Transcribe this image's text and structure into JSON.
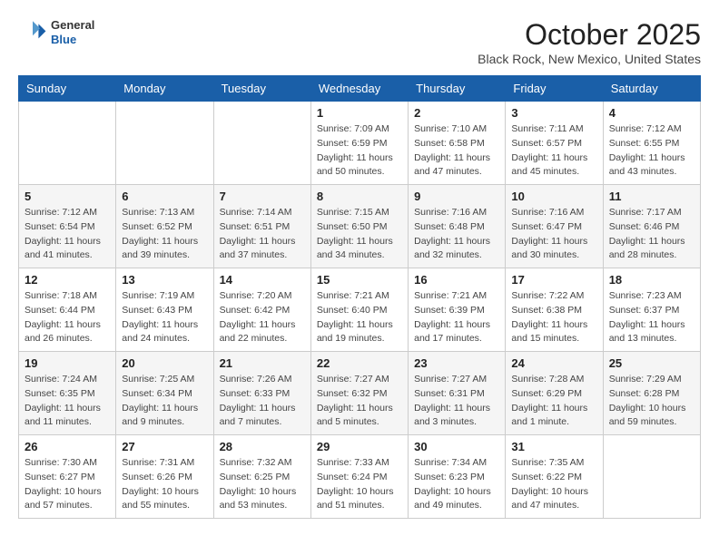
{
  "header": {
    "logo": {
      "line1": "General",
      "line2": "Blue"
    },
    "title": "October 2025",
    "subtitle": "Black Rock, New Mexico, United States"
  },
  "weekdays": [
    "Sunday",
    "Monday",
    "Tuesday",
    "Wednesday",
    "Thursday",
    "Friday",
    "Saturday"
  ],
  "weeks": [
    [
      {
        "day": "",
        "info": ""
      },
      {
        "day": "",
        "info": ""
      },
      {
        "day": "",
        "info": ""
      },
      {
        "day": "1",
        "info": "Sunrise: 7:09 AM\nSunset: 6:59 PM\nDaylight: 11 hours\nand 50 minutes."
      },
      {
        "day": "2",
        "info": "Sunrise: 7:10 AM\nSunset: 6:58 PM\nDaylight: 11 hours\nand 47 minutes."
      },
      {
        "day": "3",
        "info": "Sunrise: 7:11 AM\nSunset: 6:57 PM\nDaylight: 11 hours\nand 45 minutes."
      },
      {
        "day": "4",
        "info": "Sunrise: 7:12 AM\nSunset: 6:55 PM\nDaylight: 11 hours\nand 43 minutes."
      }
    ],
    [
      {
        "day": "5",
        "info": "Sunrise: 7:12 AM\nSunset: 6:54 PM\nDaylight: 11 hours\nand 41 minutes."
      },
      {
        "day": "6",
        "info": "Sunrise: 7:13 AM\nSunset: 6:52 PM\nDaylight: 11 hours\nand 39 minutes."
      },
      {
        "day": "7",
        "info": "Sunrise: 7:14 AM\nSunset: 6:51 PM\nDaylight: 11 hours\nand 37 minutes."
      },
      {
        "day": "8",
        "info": "Sunrise: 7:15 AM\nSunset: 6:50 PM\nDaylight: 11 hours\nand 34 minutes."
      },
      {
        "day": "9",
        "info": "Sunrise: 7:16 AM\nSunset: 6:48 PM\nDaylight: 11 hours\nand 32 minutes."
      },
      {
        "day": "10",
        "info": "Sunrise: 7:16 AM\nSunset: 6:47 PM\nDaylight: 11 hours\nand 30 minutes."
      },
      {
        "day": "11",
        "info": "Sunrise: 7:17 AM\nSunset: 6:46 PM\nDaylight: 11 hours\nand 28 minutes."
      }
    ],
    [
      {
        "day": "12",
        "info": "Sunrise: 7:18 AM\nSunset: 6:44 PM\nDaylight: 11 hours\nand 26 minutes."
      },
      {
        "day": "13",
        "info": "Sunrise: 7:19 AM\nSunset: 6:43 PM\nDaylight: 11 hours\nand 24 minutes."
      },
      {
        "day": "14",
        "info": "Sunrise: 7:20 AM\nSunset: 6:42 PM\nDaylight: 11 hours\nand 22 minutes."
      },
      {
        "day": "15",
        "info": "Sunrise: 7:21 AM\nSunset: 6:40 PM\nDaylight: 11 hours\nand 19 minutes."
      },
      {
        "day": "16",
        "info": "Sunrise: 7:21 AM\nSunset: 6:39 PM\nDaylight: 11 hours\nand 17 minutes."
      },
      {
        "day": "17",
        "info": "Sunrise: 7:22 AM\nSunset: 6:38 PM\nDaylight: 11 hours\nand 15 minutes."
      },
      {
        "day": "18",
        "info": "Sunrise: 7:23 AM\nSunset: 6:37 PM\nDaylight: 11 hours\nand 13 minutes."
      }
    ],
    [
      {
        "day": "19",
        "info": "Sunrise: 7:24 AM\nSunset: 6:35 PM\nDaylight: 11 hours\nand 11 minutes."
      },
      {
        "day": "20",
        "info": "Sunrise: 7:25 AM\nSunset: 6:34 PM\nDaylight: 11 hours\nand 9 minutes."
      },
      {
        "day": "21",
        "info": "Sunrise: 7:26 AM\nSunset: 6:33 PM\nDaylight: 11 hours\nand 7 minutes."
      },
      {
        "day": "22",
        "info": "Sunrise: 7:27 AM\nSunset: 6:32 PM\nDaylight: 11 hours\nand 5 minutes."
      },
      {
        "day": "23",
        "info": "Sunrise: 7:27 AM\nSunset: 6:31 PM\nDaylight: 11 hours\nand 3 minutes."
      },
      {
        "day": "24",
        "info": "Sunrise: 7:28 AM\nSunset: 6:29 PM\nDaylight: 11 hours\nand 1 minute."
      },
      {
        "day": "25",
        "info": "Sunrise: 7:29 AM\nSunset: 6:28 PM\nDaylight: 10 hours\nand 59 minutes."
      }
    ],
    [
      {
        "day": "26",
        "info": "Sunrise: 7:30 AM\nSunset: 6:27 PM\nDaylight: 10 hours\nand 57 minutes."
      },
      {
        "day": "27",
        "info": "Sunrise: 7:31 AM\nSunset: 6:26 PM\nDaylight: 10 hours\nand 55 minutes."
      },
      {
        "day": "28",
        "info": "Sunrise: 7:32 AM\nSunset: 6:25 PM\nDaylight: 10 hours\nand 53 minutes."
      },
      {
        "day": "29",
        "info": "Sunrise: 7:33 AM\nSunset: 6:24 PM\nDaylight: 10 hours\nand 51 minutes."
      },
      {
        "day": "30",
        "info": "Sunrise: 7:34 AM\nSunset: 6:23 PM\nDaylight: 10 hours\nand 49 minutes."
      },
      {
        "day": "31",
        "info": "Sunrise: 7:35 AM\nSunset: 6:22 PM\nDaylight: 10 hours\nand 47 minutes."
      },
      {
        "day": "",
        "info": ""
      }
    ]
  ]
}
